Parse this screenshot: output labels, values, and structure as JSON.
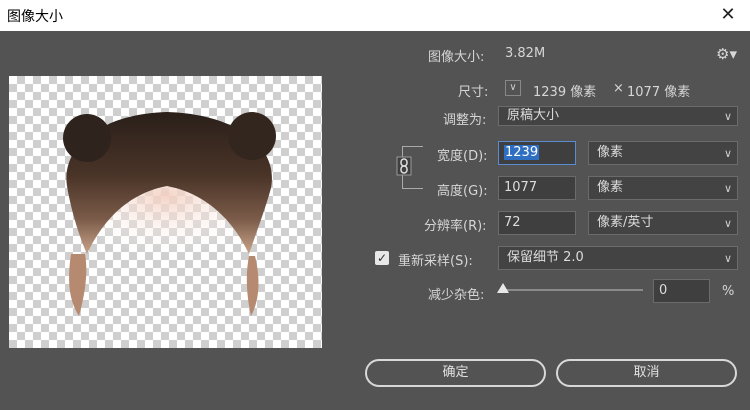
{
  "window": {
    "title": "图像大小",
    "close_glyph": "✕"
  },
  "image_size": {
    "label": "图像大小:",
    "value": "3.82M"
  },
  "settings_icon": "gear-icon",
  "dimensions": {
    "label": "尺寸:",
    "width": "1239 像素",
    "times": "×",
    "height": "1077 像素"
  },
  "fit_to": {
    "label": "调整为:",
    "value": "原稿大小"
  },
  "width": {
    "label": "宽度(D):",
    "value": "1239",
    "unit": "像素"
  },
  "height": {
    "label": "高度(G):",
    "value": "1077",
    "unit": "像素"
  },
  "resolution": {
    "label": "分辨率(R):",
    "value": "72",
    "unit": "像素/英寸"
  },
  "resample": {
    "checked": true,
    "label": "重新采样(S):",
    "value": "保留细节 2.0"
  },
  "reduce_noise": {
    "label": "减少杂色:",
    "value": "0",
    "unit": "%",
    "level": 0
  },
  "buttons": {
    "ok": "确定",
    "cancel": "取消"
  },
  "colors": {
    "panel": "#535353",
    "field": "#3f3f3f",
    "selection": "#2f6fc2"
  }
}
